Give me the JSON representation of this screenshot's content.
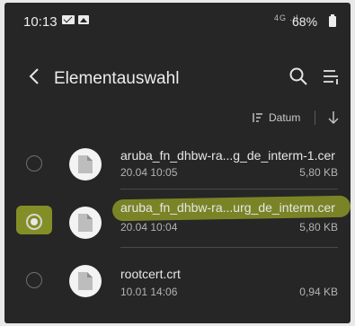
{
  "status_bar": {
    "time": "10:13",
    "signal_text": "4G .ıl",
    "battery": "68%"
  },
  "app_bar": {
    "title": "Elementauswahl"
  },
  "sort": {
    "label": "Datum"
  },
  "files": [
    {
      "name": "aruba_fn_dhbw-ra...g_de_interm-1.cer",
      "date": "20.04 10:05",
      "size": "5,80 KB",
      "selected": false
    },
    {
      "name": "aruba_fn_dhbw-ra...urg_de_interm.cer",
      "date": "20.04 10:04",
      "size": "5,80 KB",
      "selected": true
    },
    {
      "name": "rootcert.crt",
      "date": "10.01 14:06",
      "size": "0,94 KB",
      "selected": false
    }
  ],
  "colors": {
    "background": "#262626",
    "highlight": "#d2e428"
  }
}
